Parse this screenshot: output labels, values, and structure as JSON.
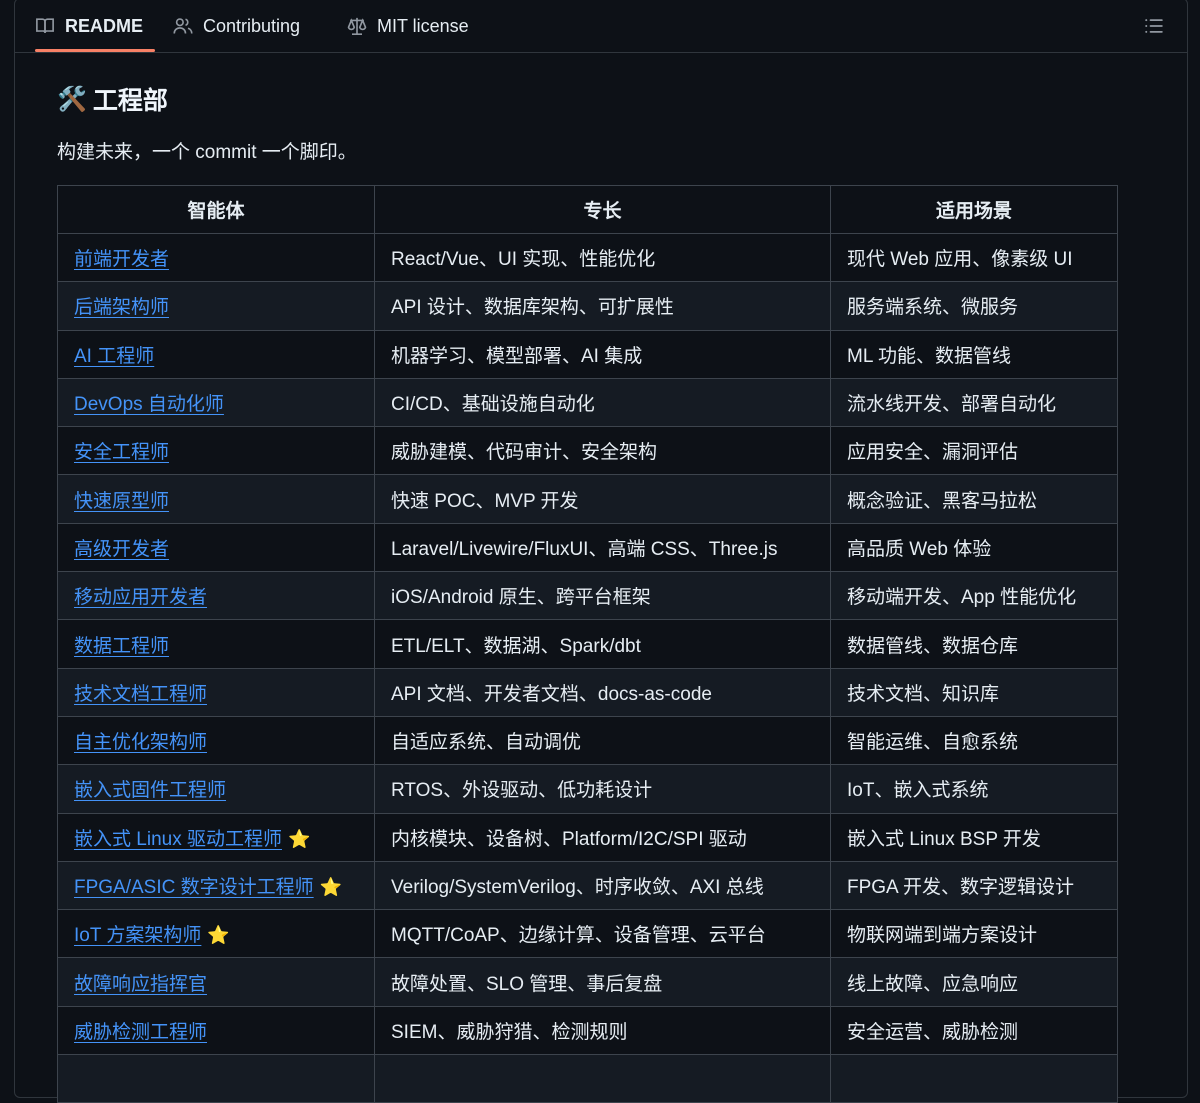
{
  "tabs": [
    {
      "label": "README",
      "icon": "book-icon",
      "active": true
    },
    {
      "label": "Contributing",
      "icon": "people-icon",
      "active": false
    },
    {
      "label": "MIT license",
      "icon": "law-icon",
      "active": false
    }
  ],
  "section": {
    "emoji": "🛠️",
    "title": "工程部",
    "intro": "构建未来，一个 commit 一个脚印。"
  },
  "table": {
    "headers": [
      "智能体",
      "专长",
      "适用场景"
    ],
    "rows": [
      {
        "agent": "前端开发者",
        "star": "",
        "specialty": "React/Vue、UI 实现、性能优化",
        "scenario": "现代 Web 应用、像素级 UI"
      },
      {
        "agent": "后端架构师",
        "star": "",
        "specialty": "API 设计、数据库架构、可扩展性",
        "scenario": "服务端系统、微服务"
      },
      {
        "agent": "AI 工程师",
        "star": "",
        "specialty": "机器学习、模型部署、AI 集成",
        "scenario": "ML 功能、数据管线"
      },
      {
        "agent": "DevOps 自动化师",
        "star": "",
        "specialty": "CI/CD、基础设施自动化",
        "scenario": "流水线开发、部署自动化"
      },
      {
        "agent": "安全工程师",
        "star": "",
        "specialty": "威胁建模、代码审计、安全架构",
        "scenario": "应用安全、漏洞评估"
      },
      {
        "agent": "快速原型师",
        "star": "",
        "specialty": "快速 POC、MVP 开发",
        "scenario": "概念验证、黑客马拉松"
      },
      {
        "agent": "高级开发者",
        "star": "",
        "specialty": "Laravel/Livewire/FluxUI、高端 CSS、Three.js",
        "scenario": "高品质 Web 体验"
      },
      {
        "agent": "移动应用开发者",
        "star": "",
        "specialty": "iOS/Android 原生、跨平台框架",
        "scenario": "移动端开发、App 性能优化"
      },
      {
        "agent": "数据工程师",
        "star": "",
        "specialty": "ETL/ELT、数据湖、Spark/dbt",
        "scenario": "数据管线、数据仓库"
      },
      {
        "agent": "技术文档工程师",
        "star": "",
        "specialty": "API 文档、开发者文档、docs-as-code",
        "scenario": "技术文档、知识库"
      },
      {
        "agent": "自主优化架构师",
        "star": "",
        "specialty": "自适应系统、自动调优",
        "scenario": "智能运维、自愈系统"
      },
      {
        "agent": "嵌入式固件工程师",
        "star": "",
        "specialty": "RTOS、外设驱动、低功耗设计",
        "scenario": "IoT、嵌入式系统"
      },
      {
        "agent": "嵌入式 Linux 驱动工程师",
        "star": "⭐",
        "specialty": "内核模块、设备树、Platform/I2C/SPI 驱动",
        "scenario": "嵌入式 Linux BSP 开发"
      },
      {
        "agent": "FPGA/ASIC 数字设计工程师",
        "star": "⭐",
        "specialty": "Verilog/SystemVerilog、时序收敛、AXI 总线",
        "scenario": "FPGA 开发、数字逻辑设计"
      },
      {
        "agent": "IoT 方案架构师",
        "star": "⭐",
        "specialty": "MQTT/CoAP、边缘计算、设备管理、云平台",
        "scenario": "物联网端到端方案设计"
      },
      {
        "agent": "故障响应指挥官",
        "star": "",
        "specialty": "故障处置、SLO 管理、事后复盘",
        "scenario": "线上故障、应急响应"
      },
      {
        "agent": "威胁检测工程师",
        "star": "",
        "specialty": "SIEM、威胁狩猎、检测规则",
        "scenario": "安全运营、威胁检测"
      },
      {
        "agent": "",
        "star": "",
        "specialty": "",
        "scenario": ""
      }
    ]
  }
}
